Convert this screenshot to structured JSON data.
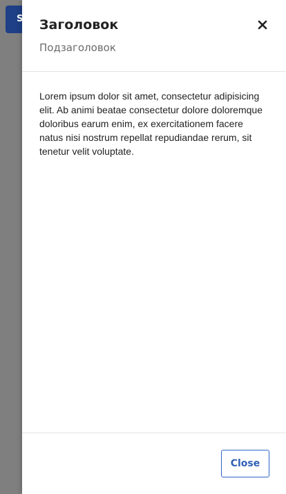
{
  "background": {
    "button_label": "Show"
  },
  "drawer": {
    "title": "Заголовок",
    "subtitle": "Подзаголовок",
    "body_text": "Lorem ipsum dolor sit amet, consectetur adipisicing elit. Ab animi beatae consectetur dolore doloremque doloribus earum enim, ex exercitationem facere natus nisi nostrum repellat repudiandae rerum, sit tenetur velit voluptate.",
    "close_icon": "close-icon",
    "footer_close_label": "Close"
  },
  "colors": {
    "backdrop": "#7f7f7f",
    "background_button": "#1f3f86",
    "accent": "#2f63c7",
    "title": "#222222",
    "subtitle": "#6b6b6b"
  }
}
